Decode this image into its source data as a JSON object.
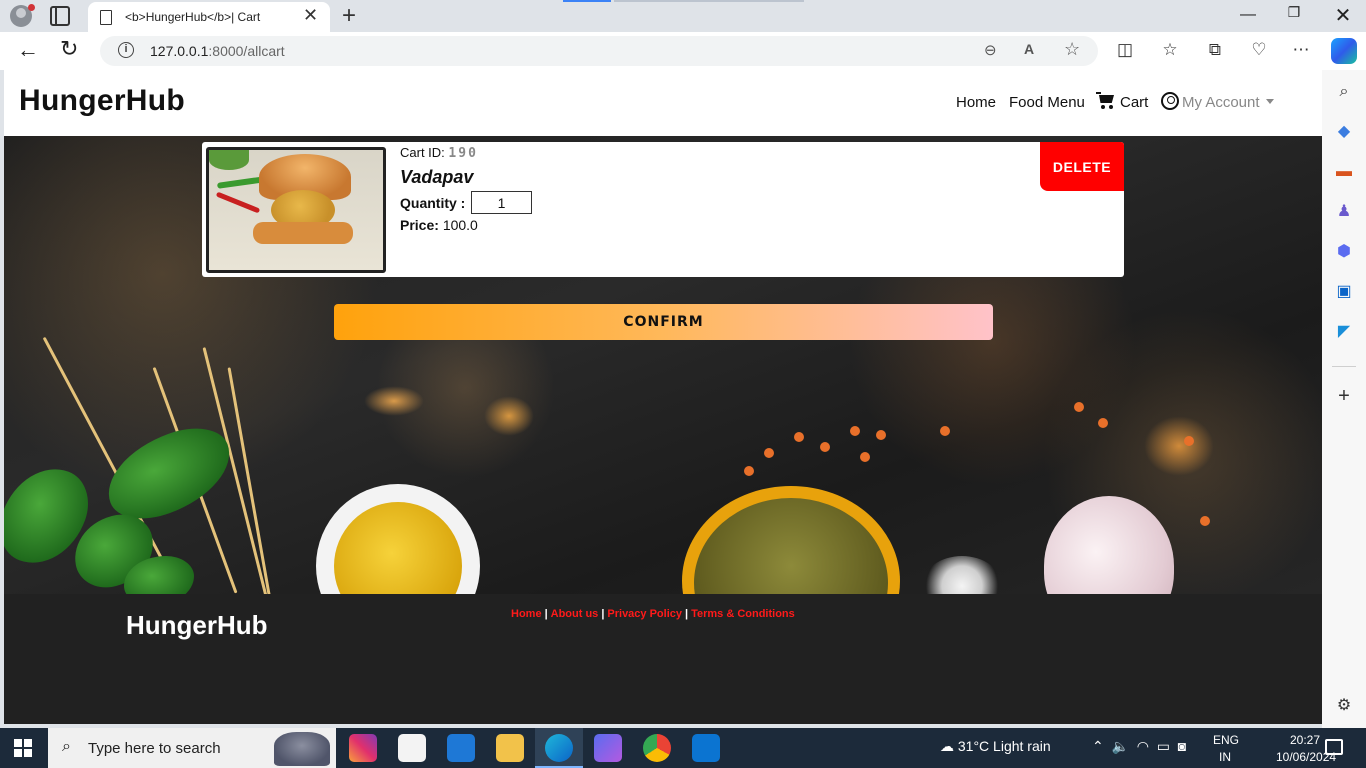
{
  "browser": {
    "tab_title": "<b>HungerHub</b>| Cart",
    "url_host": "127.0.0.1",
    "url_rest": ":8000/allcart"
  },
  "site": {
    "brand": "HungerHub",
    "nav": {
      "home": "Home",
      "food_menu": "Food Menu",
      "cart": "Cart",
      "account": "My Account"
    }
  },
  "cart": {
    "items": [
      {
        "cart_id_label": "Cart ID:",
        "cart_id": "190",
        "name": "Vadapav",
        "quantity_label": "Quantity :",
        "quantity": "1",
        "price_label": "Price:",
        "price": "100.0",
        "delete_label": "DELETE"
      }
    ],
    "confirm_label": "CONFIRM"
  },
  "footer": {
    "brand": "HungerHub",
    "links": [
      "Home",
      "About us",
      "Privacy Policy",
      "Terms & Conditions"
    ]
  },
  "taskbar": {
    "search_placeholder": "Type here to search",
    "weather": "31°C  Light rain",
    "lang_line1": "ENG",
    "lang_line2": "IN",
    "time": "20:27",
    "date": "10/06/2024"
  },
  "colors": {
    "delete": "#ff0000",
    "footer_link": "#ff1a1a",
    "confirm_start": "#ffa20c",
    "confirm_end": "#ffc2c9",
    "footer_bg": "#212121"
  }
}
